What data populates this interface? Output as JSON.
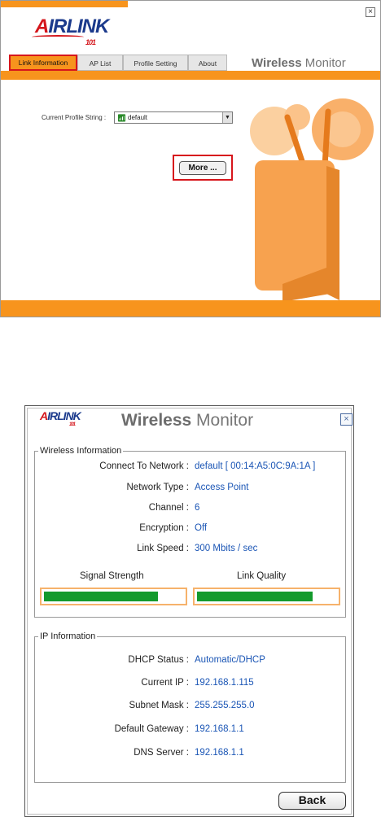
{
  "logo": {
    "a": "A",
    "rest": "IRLINK",
    "num": "101"
  },
  "top": {
    "tabs": [
      "Link Information",
      "AP List",
      "Profile Setting",
      "About"
    ],
    "brand": {
      "bold": "Wireless",
      "light": " Monitor"
    },
    "profile_label": "Current Profile String :",
    "profile_value": "default",
    "more_button": "More ...",
    "close_glyph": "×"
  },
  "bottom": {
    "brand": {
      "bold": "Wireless",
      "light": " Monitor"
    },
    "close_glyph": "×",
    "wireless": {
      "legend": "Wireless Information",
      "rows": [
        {
          "label": "Connect To Network :",
          "value": "default [ 00:14:A5:0C:9A:1A ]"
        },
        {
          "label": "Network Type :",
          "value": "Access Point"
        },
        {
          "label": "Channel :",
          "value": "6"
        },
        {
          "label": "Encryption :",
          "value": "Off"
        },
        {
          "label": "Link Speed :",
          "value": "300 Mbits / sec"
        }
      ],
      "signal_title": "Signal Strength",
      "quality_title": "Link Quality",
      "signal_level": 0.82,
      "quality_level": 0.83
    },
    "ip": {
      "legend": "IP Information",
      "rows": [
        {
          "label": "DHCP Status :",
          "value": "Automatic/DHCP"
        },
        {
          "label": "Current IP :",
          "value": "192.168.1.115"
        },
        {
          "label": "Subnet Mask :",
          "value": "255.255.255.0"
        },
        {
          "label": "Default Gateway :",
          "value": "192.168.1.1"
        },
        {
          "label": "DNS Server :",
          "value": "192.168.1.1"
        }
      ]
    },
    "back_button": "Back"
  },
  "colors": {
    "accent": "#f7941d",
    "highlight": "#d7161c",
    "value_blue": "#1a55b5",
    "meter_green": "#139a2c"
  }
}
